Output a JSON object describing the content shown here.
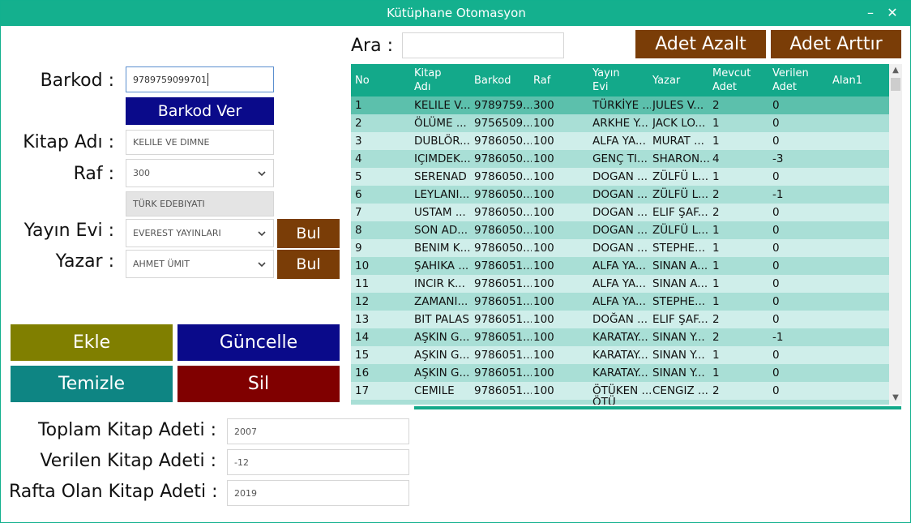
{
  "window": {
    "title": "Kütüphane Otomasyon",
    "minimize_glyph": "–",
    "close_glyph": "✕"
  },
  "form": {
    "barkod_label": "Barkod :",
    "barkod_value": "9789759099701",
    "barkod_ver_label": "Barkod Ver",
    "kitap_adi_label": "Kitap Adı :",
    "kitap_adi_value": "KELILE VE DIMNE",
    "raf_label": "Raf :",
    "raf_value": "300",
    "raf_category": "TÜRK EDEBIYATI",
    "yayin_evi_label": "Yayın Evi :",
    "yayin_evi_value": "EVEREST YAYINLARI",
    "yazar_label": "Yazar :",
    "yazar_value": "AHMET ÜMIT",
    "bul_label": "Bul"
  },
  "actions": {
    "ekle": "Ekle",
    "guncelle": "Güncelle",
    "temizle": "Temizle",
    "sil": "Sil"
  },
  "search": {
    "label": "Ara :",
    "value": "",
    "adet_azalt": "Adet Azalt",
    "adet_arttir": "Adet Arttır"
  },
  "stats": {
    "toplam_label": "Toplam Kitap Adeti :",
    "toplam_value": "2007",
    "verilen_label": "Verilen Kitap Adeti :",
    "verilen_value": "-12",
    "rafta_label": "Rafta Olan Kitap Adeti :",
    "rafta_value": "2019"
  },
  "table": {
    "columns": [
      {
        "line1": "No",
        "line2": ""
      },
      {
        "line1": "Kitap",
        "line2": "Adı"
      },
      {
        "line1": "Barkod",
        "line2": ""
      },
      {
        "line1": "Raf",
        "line2": ""
      },
      {
        "line1": "Yayın",
        "line2": "Evi"
      },
      {
        "line1": "Yazar",
        "line2": ""
      },
      {
        "line1": "Mevcut",
        "line2": "Adet"
      },
      {
        "line1": "Verilen",
        "line2": "Adet"
      },
      {
        "line1": "Alan1",
        "line2": ""
      }
    ],
    "rows": [
      [
        "1",
        "KELILE V...",
        "9789759...",
        "300",
        "TÜRKİYE ...",
        "JULES V...",
        "2",
        "0",
        ""
      ],
      [
        "2",
        "ÖLÜME ...",
        "9756509...",
        "100",
        "ARKHE Y...",
        "JACK LO...",
        "1",
        "0",
        ""
      ],
      [
        "3",
        "DUBLÖR...",
        "9786050...",
        "100",
        "ALFA YA...",
        "MURAT ...",
        "1",
        "0",
        ""
      ],
      [
        "4",
        "IÇIMDEK...",
        "9786050...",
        "100",
        "GENÇ TI...",
        "SHARON...",
        "4",
        "-3",
        ""
      ],
      [
        "5",
        "SERENAD",
        "9786050...",
        "100",
        "DOGAN ...",
        "ZÜLFÜ L...",
        "1",
        "0",
        ""
      ],
      [
        "6",
        "LEYLANI...",
        "9786050...",
        "100",
        "DOGAN ...",
        "ZÜLFÜ L...",
        "2",
        "-1",
        ""
      ],
      [
        "7",
        "USTAM ...",
        "9786050...",
        "100",
        "DOGAN ...",
        "ELIF ŞAF...",
        "2",
        "0",
        ""
      ],
      [
        "8",
        "SON AD...",
        "9786050...",
        "100",
        "DOGAN ...",
        "ZÜLFÜ L...",
        "1",
        "0",
        ""
      ],
      [
        "9",
        "BENIM K...",
        "9786050...",
        "100",
        "DOGAN ...",
        "STEPHE...",
        "1",
        "0",
        ""
      ],
      [
        "10",
        "ŞAHIKA ...",
        "9786051...",
        "100",
        "ALFA YA...",
        "SINAN A...",
        "1",
        "0",
        ""
      ],
      [
        "11",
        "INCIR K...",
        "9786051...",
        "100",
        "ALFA YA...",
        "SINAN A...",
        "1",
        "0",
        ""
      ],
      [
        "12",
        "ZAMANI...",
        "9786051...",
        "100",
        "ALFA YA...",
        "STEPHE...",
        "1",
        "0",
        ""
      ],
      [
        "13",
        "BIT PALAS",
        "9786051...",
        "100",
        "DOĞAN ...",
        "ELIF ŞAF...",
        "2",
        "0",
        ""
      ],
      [
        "14",
        "AŞKIN G...",
        "9786051...",
        "100",
        "KARATAY...",
        "SINAN Y...",
        "2",
        "-1",
        ""
      ],
      [
        "15",
        "AŞKIN G...",
        "9786051...",
        "100",
        "KARATAY...",
        "SINAN Y...",
        "1",
        "0",
        ""
      ],
      [
        "16",
        "AŞKIN G...",
        "9786051...",
        "100",
        "KARATAY...",
        "SINAN Y...",
        "1",
        "0",
        ""
      ],
      [
        "17",
        "CEMILE",
        "9786051...",
        "100",
        "ÖTÜKEN ...",
        "CENGIZ ...",
        "2",
        "0",
        ""
      ]
    ],
    "partial_row_hint": "ÖTÜ"
  },
  "colors": {
    "titlebar": "#14b08e",
    "header": "#13a98a",
    "row_selected": "#5cc0ac",
    "row_dark": "#a9dfd6",
    "row_light": "#cfeeea",
    "blue": "#0a0a8a",
    "brown": "#7a3d07",
    "olive": "#807f00",
    "teal": "#0e8583",
    "maroon": "#800000"
  },
  "icons": {
    "dropdown": "chevron-down-icon",
    "scroll_up": "arrow-up-icon",
    "scroll_down": "arrow-down-icon"
  }
}
